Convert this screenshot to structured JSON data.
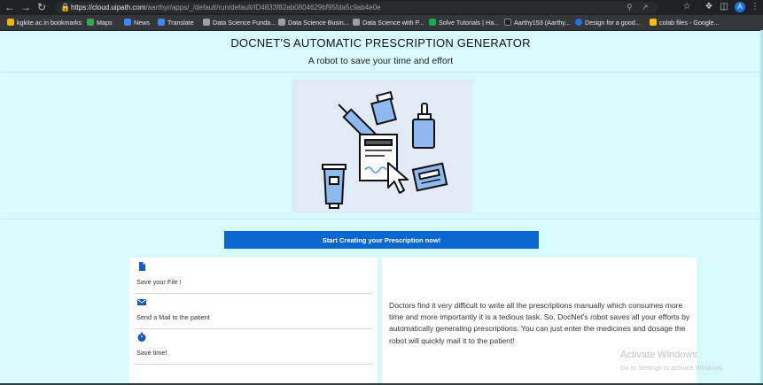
{
  "browser": {
    "url_host": "https://cloud.uipath.com",
    "url_path": "/aarthyr/apps/_/default/run/default/ID4833f82ab0804629bf95fda5c9ab4e0e",
    "avatar_letter": "A"
  },
  "bookmarks": [
    {
      "label": "kgkite.ac.in bookmarks",
      "color": "#f4b400"
    },
    {
      "label": "Maps",
      "color": "#34a853"
    },
    {
      "label": "News",
      "color": "#4285f4"
    },
    {
      "label": "Translate",
      "color": "#4285f4"
    },
    {
      "label": "Data Science Funda...",
      "color": "#9aa0a6"
    },
    {
      "label": "Data Science Busin...",
      "color": "#9aa0a6"
    },
    {
      "label": "Data Science with P...",
      "color": "#9aa0a6"
    },
    {
      "label": "Solve Tutorials | Ha...",
      "color": "#1ba94c"
    },
    {
      "label": "Aarthy153 (Aarthy...",
      "color": "#202124"
    },
    {
      "label": "Design for a good...",
      "color": "#1a73e8"
    },
    {
      "label": "colab files - Google...",
      "color": "#fbbc04"
    }
  ],
  "app": {
    "title": "DOCNET'S AUTOMATIC PRESCRIPTION GENERATOR",
    "subtitle": "A robot to save your time and effort",
    "cta_label": "Start Creating your Prescription now!",
    "features": [
      {
        "label": "Save your File !",
        "icon": "file-icon"
      },
      {
        "label": "Send a Mail to the patient",
        "icon": "mail-icon"
      },
      {
        "label": "Save time!",
        "icon": "clock-icon"
      }
    ],
    "description": "Doctors find it very difficult to write all the prescriptions manually which consumes more time and more importantly it is a tedious task. So, DocNet's robot saves all your efforts by automatically generating prescriptions. You can just enter the medicines and dosage the robot will quickly mail it to the patient!"
  },
  "os": {
    "watermark_title": "Activate Windows",
    "watermark_sub": "Go to Settings to activate Windows."
  },
  "colors": {
    "background": "#d7fbfc",
    "accent": "#0b67d0",
    "icon_blue": "#1a56c4"
  }
}
